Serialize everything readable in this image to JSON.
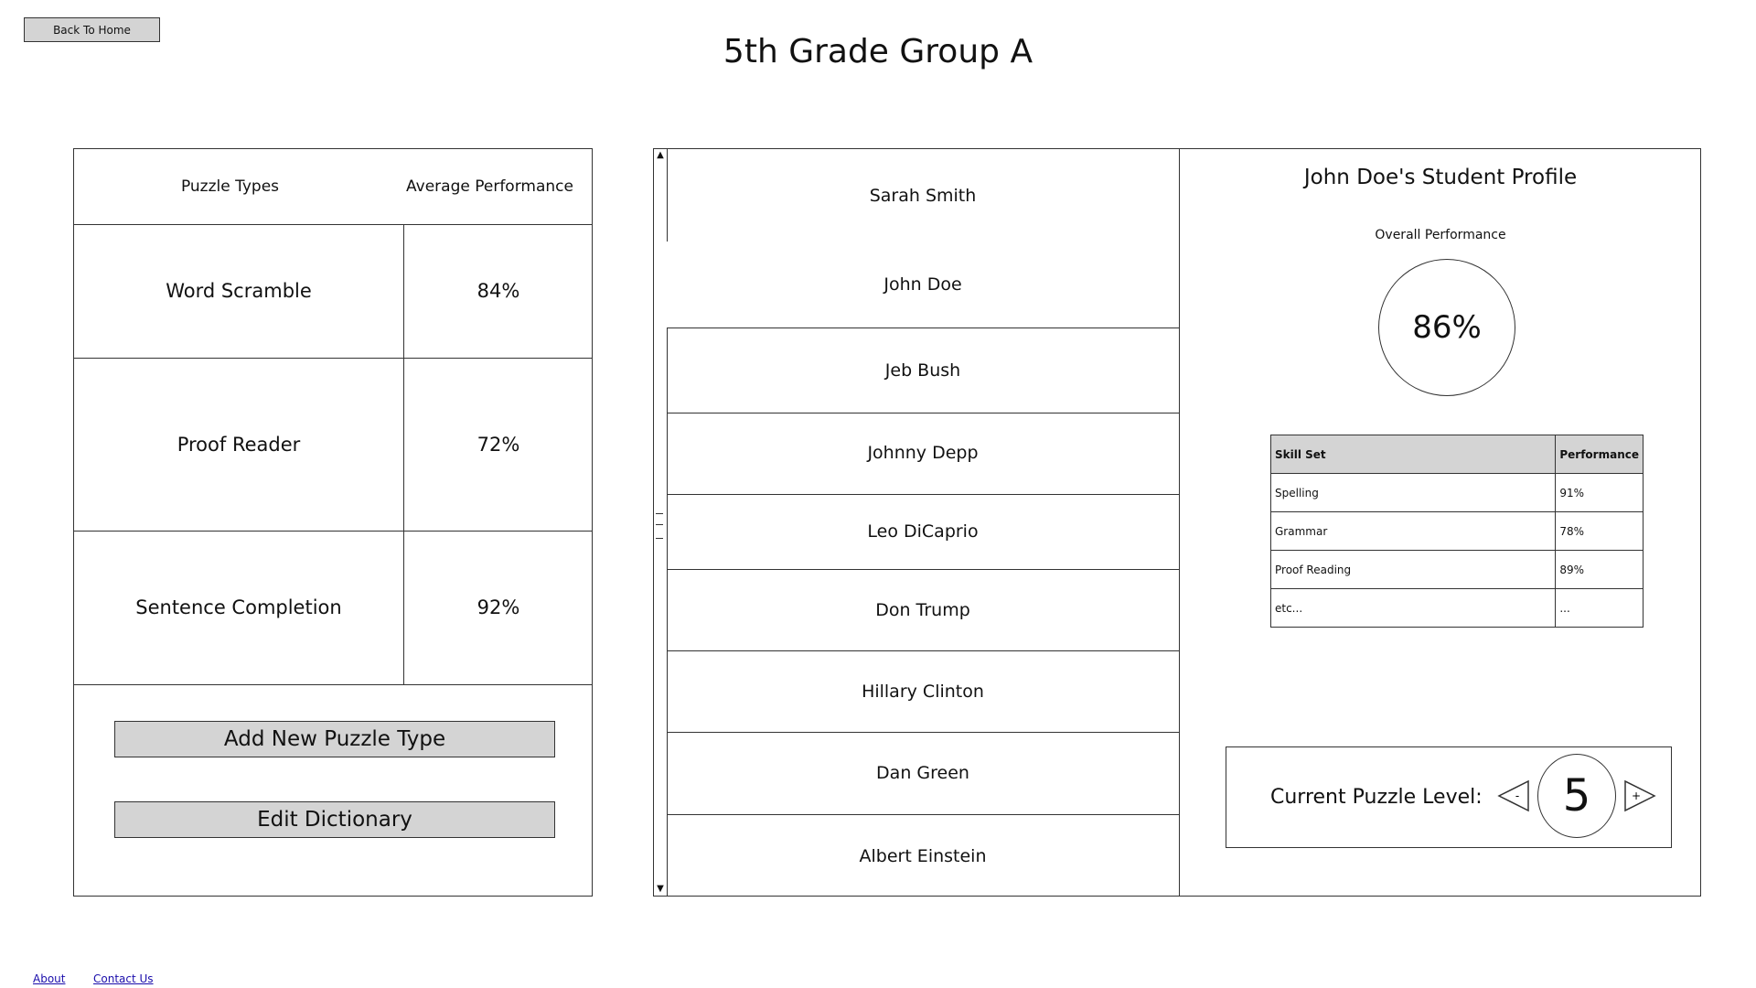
{
  "header": {
    "back_label": "Back To Home",
    "title": "5th Grade Group A"
  },
  "puzzle_table": {
    "col1": "Puzzle Types",
    "col2": "Average Performance",
    "rows": [
      {
        "type": "Word Scramble",
        "perf": "84%"
      },
      {
        "type": "Proof Reader",
        "perf": "72%"
      },
      {
        "type": "Sentence Completion",
        "perf": "92%"
      }
    ],
    "add_label": "Add New Puzzle Type",
    "edit_label": "Edit Dictionary"
  },
  "students": [
    "Sarah Smith",
    "John Doe",
    "Jeb Bush",
    "Johnny Depp",
    "Leo DiCaprio",
    "Don Trump",
    "Hillary Clinton",
    "Dan Green",
    "Albert Einstein"
  ],
  "profile": {
    "title": "John Doe's Student Profile",
    "overall_label": "Overall Performance",
    "overall_value": "86%",
    "skills_header": {
      "skill": "Skill Set",
      "perf": "Performance"
    },
    "skills": [
      {
        "skill": "Spelling",
        "perf": "91%"
      },
      {
        "skill": "Grammar",
        "perf": "78%"
      },
      {
        "skill": "Proof Reading",
        "perf": "89%"
      },
      {
        "skill": "etc...",
        "perf": "..."
      }
    ],
    "level_label": "Current Puzzle Level:",
    "level_value": "5",
    "dec_symbol": "-",
    "inc_symbol": "+"
  },
  "footer": {
    "about": "About",
    "contact": "Contact Us"
  }
}
